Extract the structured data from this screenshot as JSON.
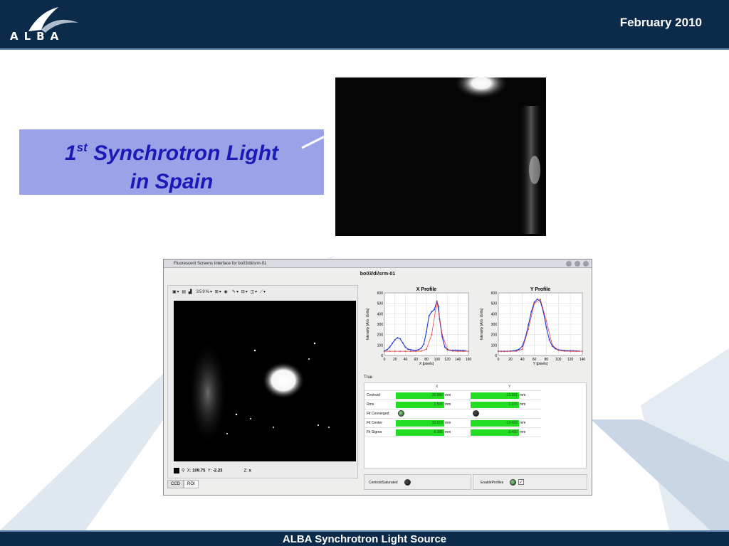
{
  "header": {
    "brand": "ALBA",
    "date": "February 2010"
  },
  "footer": {
    "text": "ALBA Synchrotron Light Source"
  },
  "callout": {
    "superscript": "st",
    "number": "1",
    "line1_rest": " Synchrotron Light",
    "line2": "in Spain"
  },
  "app": {
    "window_title": "Fluorescent Screens Interface for bo03/di/srm-01",
    "device": "bo03/di/srm-01",
    "toolbar": {
      "zoom": "359%"
    },
    "cursor": {
      "x_label": "X:",
      "x_value": "109.75",
      "y_label": "Y:",
      "y_value": "-2.23",
      "z_label": "Z:",
      "z_value": "x"
    },
    "tabs": [
      "CCD",
      "ROI"
    ],
    "true_label": "True",
    "table": {
      "col_x": "X",
      "col_y": "Y",
      "rows": [
        {
          "label": "Centroid",
          "x": "32.880",
          "x_unit": "mm",
          "y": "-13.581",
          "y_unit": "mm"
        },
        {
          "label": "Rms",
          "x": "1.506",
          "x_unit": "mm",
          "y": "1.070",
          "y_unit": "mm"
        },
        {
          "label": "Fit Converged",
          "x": "",
          "x_unit": "",
          "y": "",
          "y_unit": ""
        },
        {
          "label": "Fit Center",
          "x": "33.513",
          "x_unit": "mm",
          "y": "-13.422",
          "y_unit": "mm"
        },
        {
          "label": "Fit Sigma",
          "x": "0.385",
          "x_unit": "mm",
          "y": "0.416",
          "y_unit": "mm"
        }
      ]
    },
    "status": {
      "left_label": "CentroidSaturated",
      "right_label": "EnableProfiles"
    }
  },
  "chart_data": [
    {
      "type": "scatter",
      "title": "X Profile",
      "xlabel": "X [pixels]",
      "ylabel": "Intensity [Arb. Units]",
      "xlim": [
        0,
        160
      ],
      "ylim": [
        0,
        600
      ],
      "xticks": [
        0,
        20,
        40,
        60,
        80,
        100,
        120,
        140,
        160
      ],
      "yticks": [
        0,
        100,
        200,
        300,
        400,
        500,
        600
      ],
      "grid": true,
      "series": [
        {
          "color": "#1f3bd8",
          "x": [
            0,
            5,
            10,
            15,
            20,
            25,
            30,
            35,
            40,
            45,
            50,
            55,
            60,
            65,
            70,
            75,
            80,
            85,
            90,
            95,
            100,
            103,
            105,
            110,
            115,
            120,
            125,
            130,
            135,
            140,
            145,
            150,
            155
          ],
          "y": [
            45,
            55,
            80,
            115,
            150,
            170,
            160,
            120,
            80,
            60,
            55,
            50,
            50,
            55,
            70,
            110,
            230,
            380,
            420,
            440,
            520,
            470,
            350,
            180,
            80,
            55,
            50,
            50,
            50,
            50,
            48,
            47,
            46
          ]
        },
        {
          "color": "#e03030",
          "x": [
            0,
            10,
            20,
            30,
            40,
            50,
            60,
            70,
            80,
            90,
            100,
            110,
            120,
            130,
            140,
            150,
            160
          ],
          "y": [
            40,
            40,
            40,
            40,
            40,
            40,
            40,
            42,
            60,
            200,
            520,
            200,
            60,
            42,
            40,
            40,
            40
          ]
        }
      ]
    },
    {
      "type": "scatter",
      "title": "Y Profile",
      "xlabel": "Y [pixels]",
      "ylabel": "Intensity [Arb. Units]",
      "xlim": [
        0,
        140
      ],
      "ylim": [
        0,
        600
      ],
      "xticks": [
        0,
        20,
        40,
        60,
        80,
        100,
        120,
        140
      ],
      "yticks": [
        0,
        100,
        200,
        300,
        400,
        500,
        600
      ],
      "grid": true,
      "series": [
        {
          "color": "#1f3bd8",
          "x": [
            0,
            5,
            10,
            15,
            20,
            25,
            30,
            35,
            40,
            45,
            50,
            55,
            60,
            65,
            70,
            75,
            80,
            85,
            90,
            95,
            100,
            105,
            110,
            115,
            120,
            125,
            130,
            135
          ],
          "y": [
            40,
            40,
            40,
            40,
            42,
            45,
            50,
            60,
            90,
            170,
            290,
            420,
            510,
            540,
            520,
            420,
            270,
            150,
            90,
            65,
            55,
            50,
            48,
            46,
            45,
            44,
            43,
            42
          ]
        },
        {
          "color": "#e03030",
          "x": [
            0,
            10,
            20,
            30,
            40,
            50,
            60,
            70,
            80,
            90,
            100,
            110,
            120,
            130,
            140
          ],
          "y": [
            40,
            40,
            40,
            41,
            60,
            250,
            500,
            540,
            330,
            100,
            50,
            42,
            40,
            40,
            40
          ]
        }
      ]
    }
  ]
}
